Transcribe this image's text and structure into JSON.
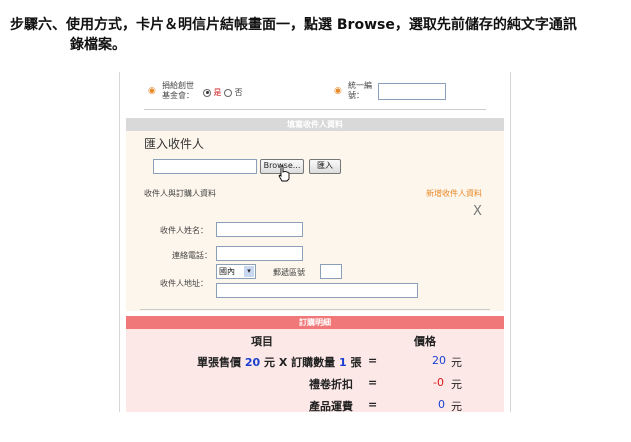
{
  "step_text_line1": "步驟六、使用方式，卡片＆明信片結帳畫面一，點選 Browse，選取先前儲存的純文字通訊",
  "step_text_line2": "錄檔案。",
  "form": {
    "donation_label_1": "捐給創世",
    "donation_label_2": "基金會：",
    "donation_yes": "是",
    "donation_no": "否",
    "tax_id_label_1": "統一編",
    "tax_id_label_2": "號：",
    "tax_id_value": ""
  },
  "recipient_section": {
    "band_title": "填寫收件人資料",
    "import_heading": "匯入收件人",
    "file_value": "",
    "browse_label": "Browse...",
    "import_button": "匯入",
    "recipient_buyer_label": "收件人與訂購人資料",
    "add_recipient_link": "新增收件人資料",
    "close_glyph": "X",
    "name_label": "收件人姓名：",
    "phone_label": "連絡電話：",
    "address_label": "收件人地址：",
    "region_value": "國內",
    "postal_label": "郵遞區號",
    "name_value": "",
    "phone_value": "",
    "postal_value": "",
    "address_value": ""
  },
  "order_section": {
    "band_title": "訂購明細",
    "col_item": "項目",
    "col_price": "價格",
    "unit_price_label": "單張售價",
    "unit_price": "20",
    "unit_currency": "元",
    "times": "X",
    "qty_label": "訂購數量",
    "qty": "1",
    "qty_unit": "張",
    "equals": "=",
    "subtotal": "20",
    "currency": "元",
    "discount_label": "禮卷折扣",
    "discount": "-0",
    "shipping_label": "產品運費",
    "shipping": "0"
  },
  "colors": {
    "recipient_band": "#d9d9d9",
    "order_band": "#f07878",
    "recipient_bg": "#fdf6ec",
    "order_bg": "#fde8e8",
    "accent_orange": "#e8892a",
    "value_blue": "#1a3fd0",
    "value_red": "#e01818"
  }
}
